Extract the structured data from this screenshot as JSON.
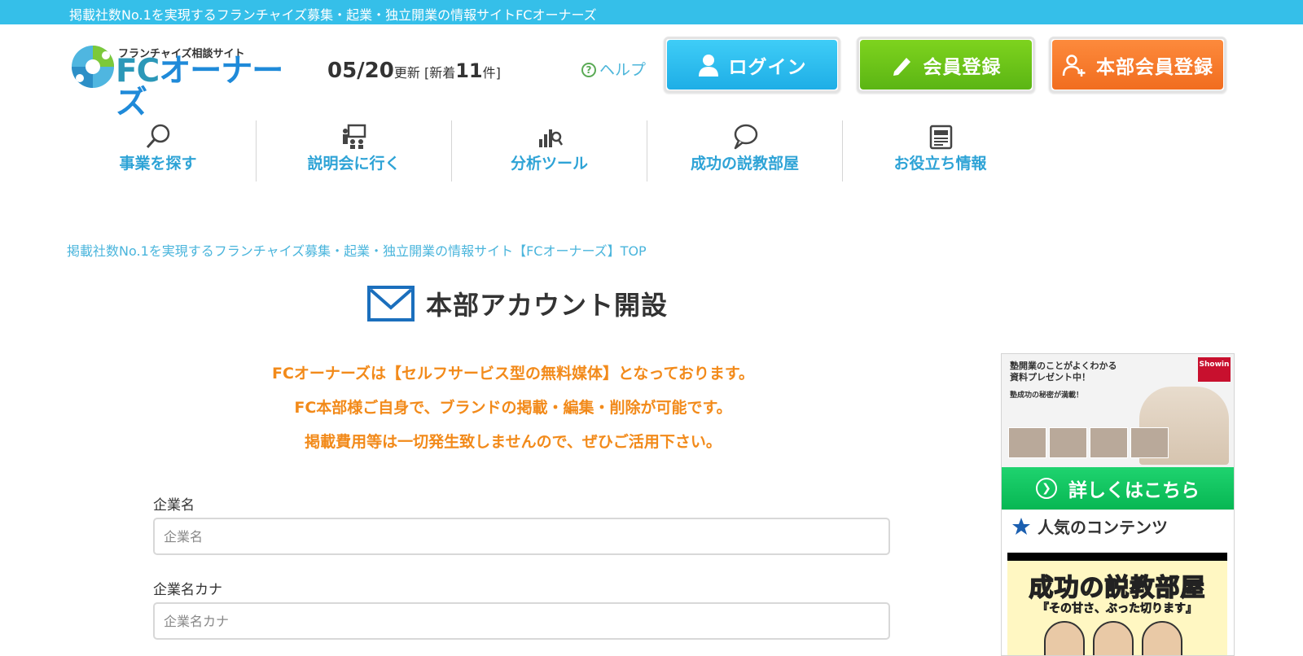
{
  "topbar": {
    "text": "掲載社数No.1を実現するフランチャイズ募集・起業・独立開業の情報サイトFCオーナーズ"
  },
  "logo": {
    "sub": "フランチャイズ相談サイト",
    "main_fc": "FC",
    "main_rest": "オーナーズ"
  },
  "update": {
    "date": "05/20",
    "date_suffix": "更新",
    "new_prefix": "[新着",
    "new_count": "11",
    "new_suffix": "件]"
  },
  "help": {
    "label": "ヘルプ"
  },
  "buttons": {
    "login": "ログイン",
    "member": "会員登録",
    "hq": "本部会員登録"
  },
  "nav": [
    {
      "label": "事業を探す",
      "icon": "search-icon"
    },
    {
      "label": "説明会に行く",
      "icon": "seminar-icon"
    },
    {
      "label": "分析ツール",
      "icon": "analytics-icon"
    },
    {
      "label": "成功の説教部屋",
      "icon": "speech-bubble-icon"
    },
    {
      "label": "お役立ち情報",
      "icon": "newspaper-icon"
    }
  ],
  "breadcrumb": "掲載社数No.1を実現するフランチャイズ募集・起業・独立開業の情報サイト【FCオーナーズ】TOP",
  "page_title": "本部アカウント開設",
  "intro": [
    "FCオーナーズは【セルフサービス型の無料媒体】となっております。",
    "FC本部様ご自身で、ブランドの掲載・編集・削除が可能です。",
    "掲載費用等は一切発生致しませんので、ぜひご活用下さい。"
  ],
  "form": {
    "company_name": {
      "label": "企業名",
      "placeholder": "企業名"
    },
    "company_kana": {
      "label": "企業名カナ",
      "placeholder": "企業名カナ"
    }
  },
  "sidebar": {
    "ad": {
      "line1": "塾開業のことがよくわかる",
      "line2": "資料プレゼント中！",
      "line3": "塾成功の秘密が満載！",
      "badge": "Showin",
      "cta": "詳しくはこちら"
    },
    "popular_heading": "人気のコンテンツ",
    "banner_title": "成功の説教部屋",
    "banner_sub": "『その甘さ、ぶった切ります』"
  },
  "colors": {
    "accent": "#35bfe9",
    "orange": "#f28a1a",
    "link": "#2ea3d6"
  }
}
